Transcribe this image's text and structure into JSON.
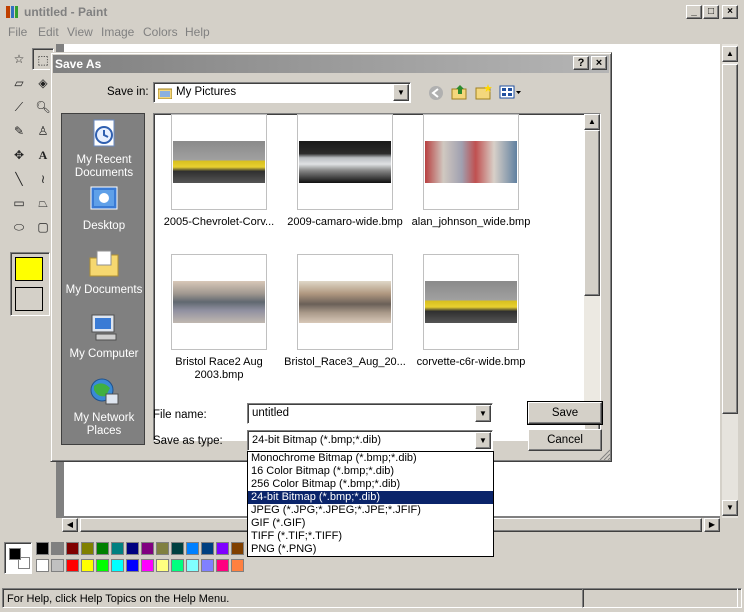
{
  "window": {
    "title": "untitled - Paint"
  },
  "menu": [
    "File",
    "Edit",
    "View",
    "Image",
    "Colors",
    "Help"
  ],
  "status": "For Help, click Help Topics on the Help Menu.",
  "palette": {
    "row1": [
      "#000000",
      "#808080",
      "#800000",
      "#808000",
      "#008000",
      "#008080",
      "#000080",
      "#800080",
      "#808040",
      "#004040",
      "#0080ff",
      "#004080",
      "#8000ff",
      "#804000"
    ],
    "row2": [
      "#ffffff",
      "#c0c0c0",
      "#ff0000",
      "#ffff00",
      "#00ff00",
      "#00ffff",
      "#0000ff",
      "#ff00ff",
      "#ffff80",
      "#00ff80",
      "#80ffff",
      "#8080ff",
      "#ff0080",
      "#ff8040"
    ]
  },
  "dialog": {
    "title": "Save As",
    "save_in_label": "Save in:",
    "save_in_value": "My Pictures",
    "places": [
      "My Recent Documents",
      "Desktop",
      "My Documents",
      "My Computer",
      "My Network Places"
    ],
    "files": [
      {
        "name": "2005-Chevrolet-Corv...",
        "pic": "car-yellow"
      },
      {
        "name": "2009-camaro-wide.bmp",
        "pic": "car-silver"
      },
      {
        "name": "alan_johnson_wide.bmp",
        "pic": "race-action"
      },
      {
        "name": "Bristol Race2 Aug 2003.bmp",
        "pic": "stadium"
      },
      {
        "name": "Bristol_Race3_Aug_20...",
        "pic": "stadium2"
      },
      {
        "name": "corvette-c6r-wide.bmp",
        "pic": "car-yellow"
      }
    ],
    "file_name_label": "File name:",
    "file_name_value": "untitled",
    "save_type_label": "Save as type:",
    "save_type_value": "24-bit Bitmap (*.bmp;*.dib)",
    "save_button": "Save",
    "cancel_button": "Cancel",
    "type_options": [
      "Monochrome Bitmap (*.bmp;*.dib)",
      "16 Color Bitmap (*.bmp;*.dib)",
      "256 Color Bitmap (*.bmp;*.dib)",
      "24-bit Bitmap (*.bmp;*.dib)",
      "JPEG (*.JPG;*.JPEG;*.JPE;*.JFIF)",
      "GIF (*.GIF)",
      "TIFF (*.TIF;*.TIFF)",
      "PNG (*.PNG)"
    ],
    "selected_type_index": 3
  }
}
